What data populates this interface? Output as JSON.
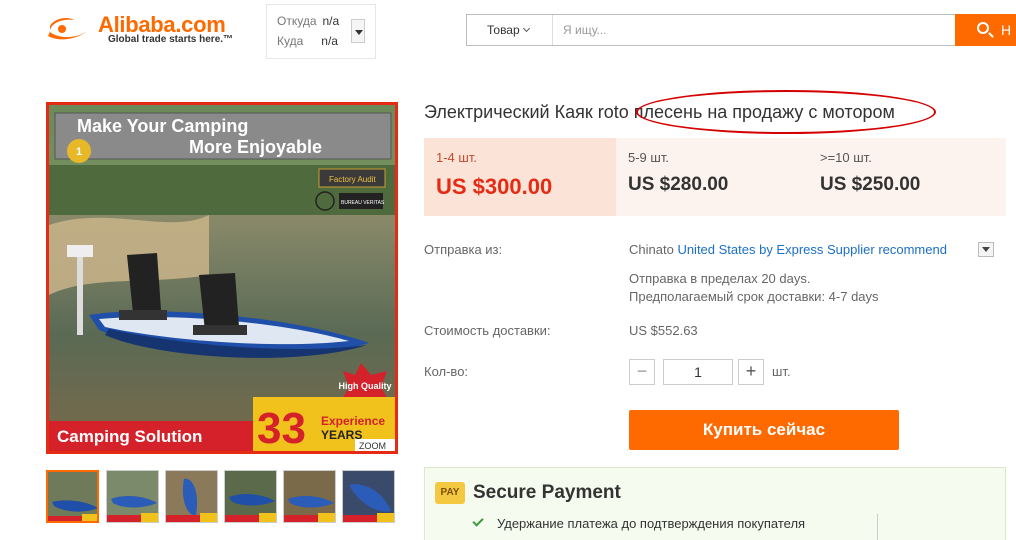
{
  "header": {
    "logo_text": "Alibaba.com",
    "logo_tagline": "Global trade starts here.™",
    "ship_from_label": "Откуда",
    "ship_from_value": "n/a",
    "ship_to_label": "Куда",
    "ship_to_value": "n/a",
    "search_category": "Товар",
    "search_placeholder": "Я ищу...",
    "search_button_text": "Н"
  },
  "gallery": {
    "banner_top_line1": "Make Your Camping",
    "banner_top_line2": "More Enjoyable",
    "badge_number": "1",
    "badge_factory": "Factory Audit",
    "badge_bureau": "BUREAU VERITAS",
    "badge_quality": "High Quality",
    "bottom_text": "Camping Solution",
    "years_number": "33",
    "years_label1": "Experience",
    "years_label2": "YEARS",
    "zoom_label": "ZOOM",
    "thumbnail_count": 6
  },
  "product": {
    "title": "Электрический Каяк roto плесень на продажу с мотором"
  },
  "price_tiers": [
    {
      "qty": "1-4 шт.",
      "price": "US $300.00"
    },
    {
      "qty": "5-9 шт.",
      "price": "US $280.00"
    },
    {
      "qty": ">=10 шт.",
      "price": "US $250.00"
    }
  ],
  "shipping": {
    "label": "Отправка из:",
    "from": "China",
    "to_word": "to",
    "route": "United States by Express Supplier recommend",
    "time": "Отправка в пределах 20 days.",
    "estimate": "Предполагаемый срок доставки: 4-7 days"
  },
  "shipping_cost": {
    "label": "Стоимость доставки:",
    "value": "US $552.63"
  },
  "quantity": {
    "label": "Кол-во:",
    "value": "1",
    "unit": "шт.",
    "minus": "−",
    "plus": "+"
  },
  "buy_button": "Купить сейчас",
  "secure_payment": {
    "icon_text": "PAY",
    "title": "Secure Payment",
    "item": "Удержание платежа до подтверждения покупателя"
  }
}
